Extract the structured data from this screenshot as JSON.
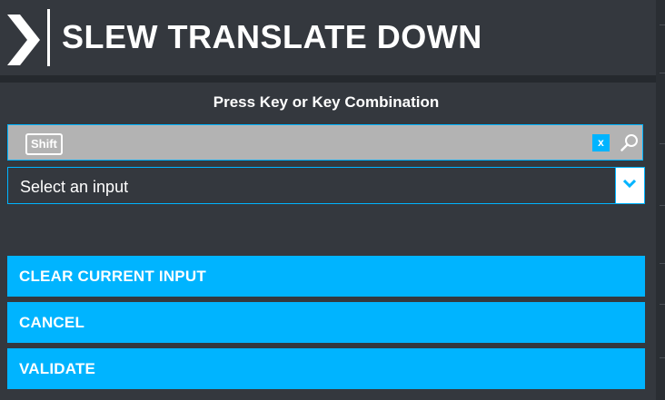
{
  "dialog": {
    "title": "SLEW TRANSLATE DOWN",
    "prompt": "Press Key or Key Combination"
  },
  "key_input": {
    "keys": [
      "Shift"
    ],
    "clear_label": "x"
  },
  "input_select": {
    "selected": "Select an input"
  },
  "buttons": {
    "clear_current_input": "CLEAR CURRENT INPUT",
    "cancel": "CANCEL",
    "validate": "VALIDATE"
  },
  "colors": {
    "accent": "#00b4ff",
    "panel": "#34383e",
    "field": "#b3b3b3"
  },
  "icons": [
    "chevron-logo-icon",
    "search-icon",
    "chevron-down-icon"
  ]
}
